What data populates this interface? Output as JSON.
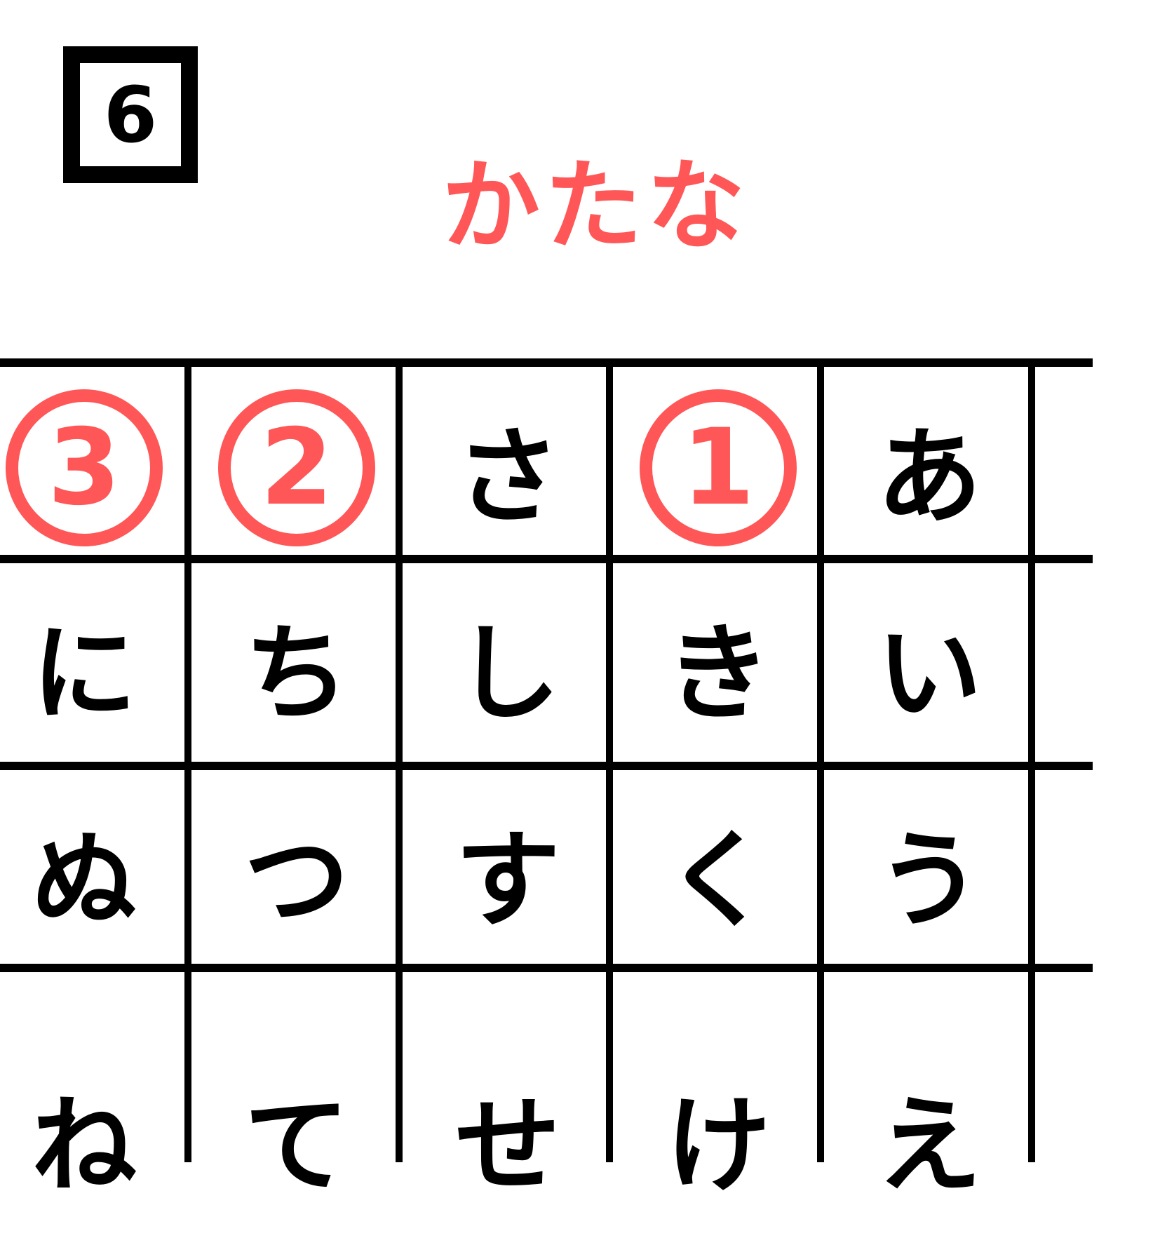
{
  "question_number": "6",
  "title": "かたな",
  "accent_color": "#ff5757",
  "grid": {
    "rows": [
      [
        {
          "type": "circle",
          "text": "3"
        },
        {
          "type": "circle",
          "text": "2"
        },
        {
          "type": "kana",
          "text": "さ"
        },
        {
          "type": "circle",
          "text": "1"
        },
        {
          "type": "kana",
          "text": "あ"
        }
      ],
      [
        {
          "type": "kana",
          "text": "に"
        },
        {
          "type": "kana",
          "text": "ち"
        },
        {
          "type": "kana",
          "text": "し"
        },
        {
          "type": "kana",
          "text": "き"
        },
        {
          "type": "kana",
          "text": "い"
        }
      ],
      [
        {
          "type": "kana",
          "text": "ぬ"
        },
        {
          "type": "kana",
          "text": "つ"
        },
        {
          "type": "kana",
          "text": "す"
        },
        {
          "type": "kana",
          "text": "く"
        },
        {
          "type": "kana",
          "text": "う"
        }
      ],
      [
        {
          "type": "kana",
          "text": "ね"
        },
        {
          "type": "kana",
          "text": "て"
        },
        {
          "type": "kana",
          "text": "せ"
        },
        {
          "type": "kana",
          "text": "け"
        },
        {
          "type": "kana",
          "text": "え"
        }
      ]
    ]
  }
}
